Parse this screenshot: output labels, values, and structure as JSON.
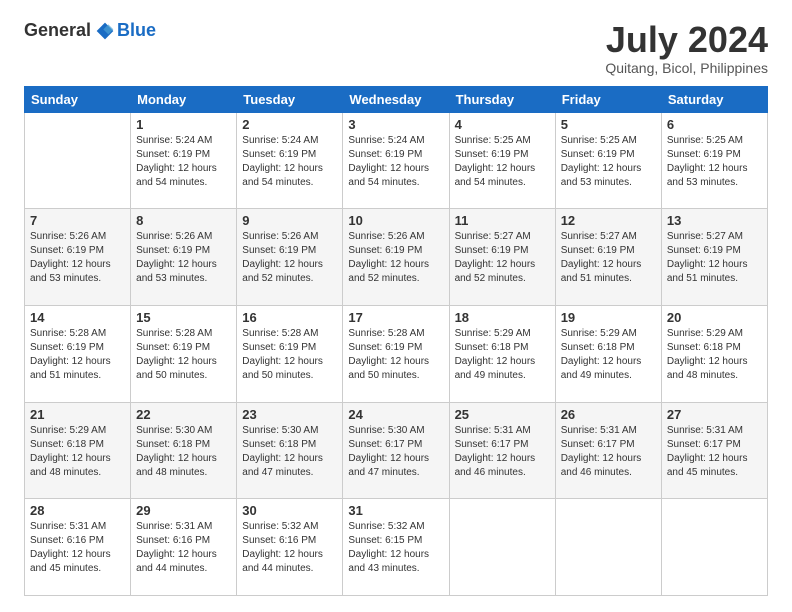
{
  "logo": {
    "general": "General",
    "blue": "Blue"
  },
  "title": "July 2024",
  "location": "Quitang, Bicol, Philippines",
  "days_of_week": [
    "Sunday",
    "Monday",
    "Tuesday",
    "Wednesday",
    "Thursday",
    "Friday",
    "Saturday"
  ],
  "weeks": [
    [
      {
        "day": "",
        "info": ""
      },
      {
        "day": "1",
        "info": "Sunrise: 5:24 AM\nSunset: 6:19 PM\nDaylight: 12 hours\nand 54 minutes."
      },
      {
        "day": "2",
        "info": "Sunrise: 5:24 AM\nSunset: 6:19 PM\nDaylight: 12 hours\nand 54 minutes."
      },
      {
        "day": "3",
        "info": "Sunrise: 5:24 AM\nSunset: 6:19 PM\nDaylight: 12 hours\nand 54 minutes."
      },
      {
        "day": "4",
        "info": "Sunrise: 5:25 AM\nSunset: 6:19 PM\nDaylight: 12 hours\nand 54 minutes."
      },
      {
        "day": "5",
        "info": "Sunrise: 5:25 AM\nSunset: 6:19 PM\nDaylight: 12 hours\nand 53 minutes."
      },
      {
        "day": "6",
        "info": "Sunrise: 5:25 AM\nSunset: 6:19 PM\nDaylight: 12 hours\nand 53 minutes."
      }
    ],
    [
      {
        "day": "7",
        "info": "Sunrise: 5:26 AM\nSunset: 6:19 PM\nDaylight: 12 hours\nand 53 minutes."
      },
      {
        "day": "8",
        "info": "Sunrise: 5:26 AM\nSunset: 6:19 PM\nDaylight: 12 hours\nand 53 minutes."
      },
      {
        "day": "9",
        "info": "Sunrise: 5:26 AM\nSunset: 6:19 PM\nDaylight: 12 hours\nand 52 minutes."
      },
      {
        "day": "10",
        "info": "Sunrise: 5:26 AM\nSunset: 6:19 PM\nDaylight: 12 hours\nand 52 minutes."
      },
      {
        "day": "11",
        "info": "Sunrise: 5:27 AM\nSunset: 6:19 PM\nDaylight: 12 hours\nand 52 minutes."
      },
      {
        "day": "12",
        "info": "Sunrise: 5:27 AM\nSunset: 6:19 PM\nDaylight: 12 hours\nand 51 minutes."
      },
      {
        "day": "13",
        "info": "Sunrise: 5:27 AM\nSunset: 6:19 PM\nDaylight: 12 hours\nand 51 minutes."
      }
    ],
    [
      {
        "day": "14",
        "info": "Sunrise: 5:28 AM\nSunset: 6:19 PM\nDaylight: 12 hours\nand 51 minutes."
      },
      {
        "day": "15",
        "info": "Sunrise: 5:28 AM\nSunset: 6:19 PM\nDaylight: 12 hours\nand 50 minutes."
      },
      {
        "day": "16",
        "info": "Sunrise: 5:28 AM\nSunset: 6:19 PM\nDaylight: 12 hours\nand 50 minutes."
      },
      {
        "day": "17",
        "info": "Sunrise: 5:28 AM\nSunset: 6:19 PM\nDaylight: 12 hours\nand 50 minutes."
      },
      {
        "day": "18",
        "info": "Sunrise: 5:29 AM\nSunset: 6:18 PM\nDaylight: 12 hours\nand 49 minutes."
      },
      {
        "day": "19",
        "info": "Sunrise: 5:29 AM\nSunset: 6:18 PM\nDaylight: 12 hours\nand 49 minutes."
      },
      {
        "day": "20",
        "info": "Sunrise: 5:29 AM\nSunset: 6:18 PM\nDaylight: 12 hours\nand 48 minutes."
      }
    ],
    [
      {
        "day": "21",
        "info": "Sunrise: 5:29 AM\nSunset: 6:18 PM\nDaylight: 12 hours\nand 48 minutes."
      },
      {
        "day": "22",
        "info": "Sunrise: 5:30 AM\nSunset: 6:18 PM\nDaylight: 12 hours\nand 48 minutes."
      },
      {
        "day": "23",
        "info": "Sunrise: 5:30 AM\nSunset: 6:18 PM\nDaylight: 12 hours\nand 47 minutes."
      },
      {
        "day": "24",
        "info": "Sunrise: 5:30 AM\nSunset: 6:17 PM\nDaylight: 12 hours\nand 47 minutes."
      },
      {
        "day": "25",
        "info": "Sunrise: 5:31 AM\nSunset: 6:17 PM\nDaylight: 12 hours\nand 46 minutes."
      },
      {
        "day": "26",
        "info": "Sunrise: 5:31 AM\nSunset: 6:17 PM\nDaylight: 12 hours\nand 46 minutes."
      },
      {
        "day": "27",
        "info": "Sunrise: 5:31 AM\nSunset: 6:17 PM\nDaylight: 12 hours\nand 45 minutes."
      }
    ],
    [
      {
        "day": "28",
        "info": "Sunrise: 5:31 AM\nSunset: 6:16 PM\nDaylight: 12 hours\nand 45 minutes."
      },
      {
        "day": "29",
        "info": "Sunrise: 5:31 AM\nSunset: 6:16 PM\nDaylight: 12 hours\nand 44 minutes."
      },
      {
        "day": "30",
        "info": "Sunrise: 5:32 AM\nSunset: 6:16 PM\nDaylight: 12 hours\nand 44 minutes."
      },
      {
        "day": "31",
        "info": "Sunrise: 5:32 AM\nSunset: 6:15 PM\nDaylight: 12 hours\nand 43 minutes."
      },
      {
        "day": "",
        "info": ""
      },
      {
        "day": "",
        "info": ""
      },
      {
        "day": "",
        "info": ""
      }
    ]
  ]
}
